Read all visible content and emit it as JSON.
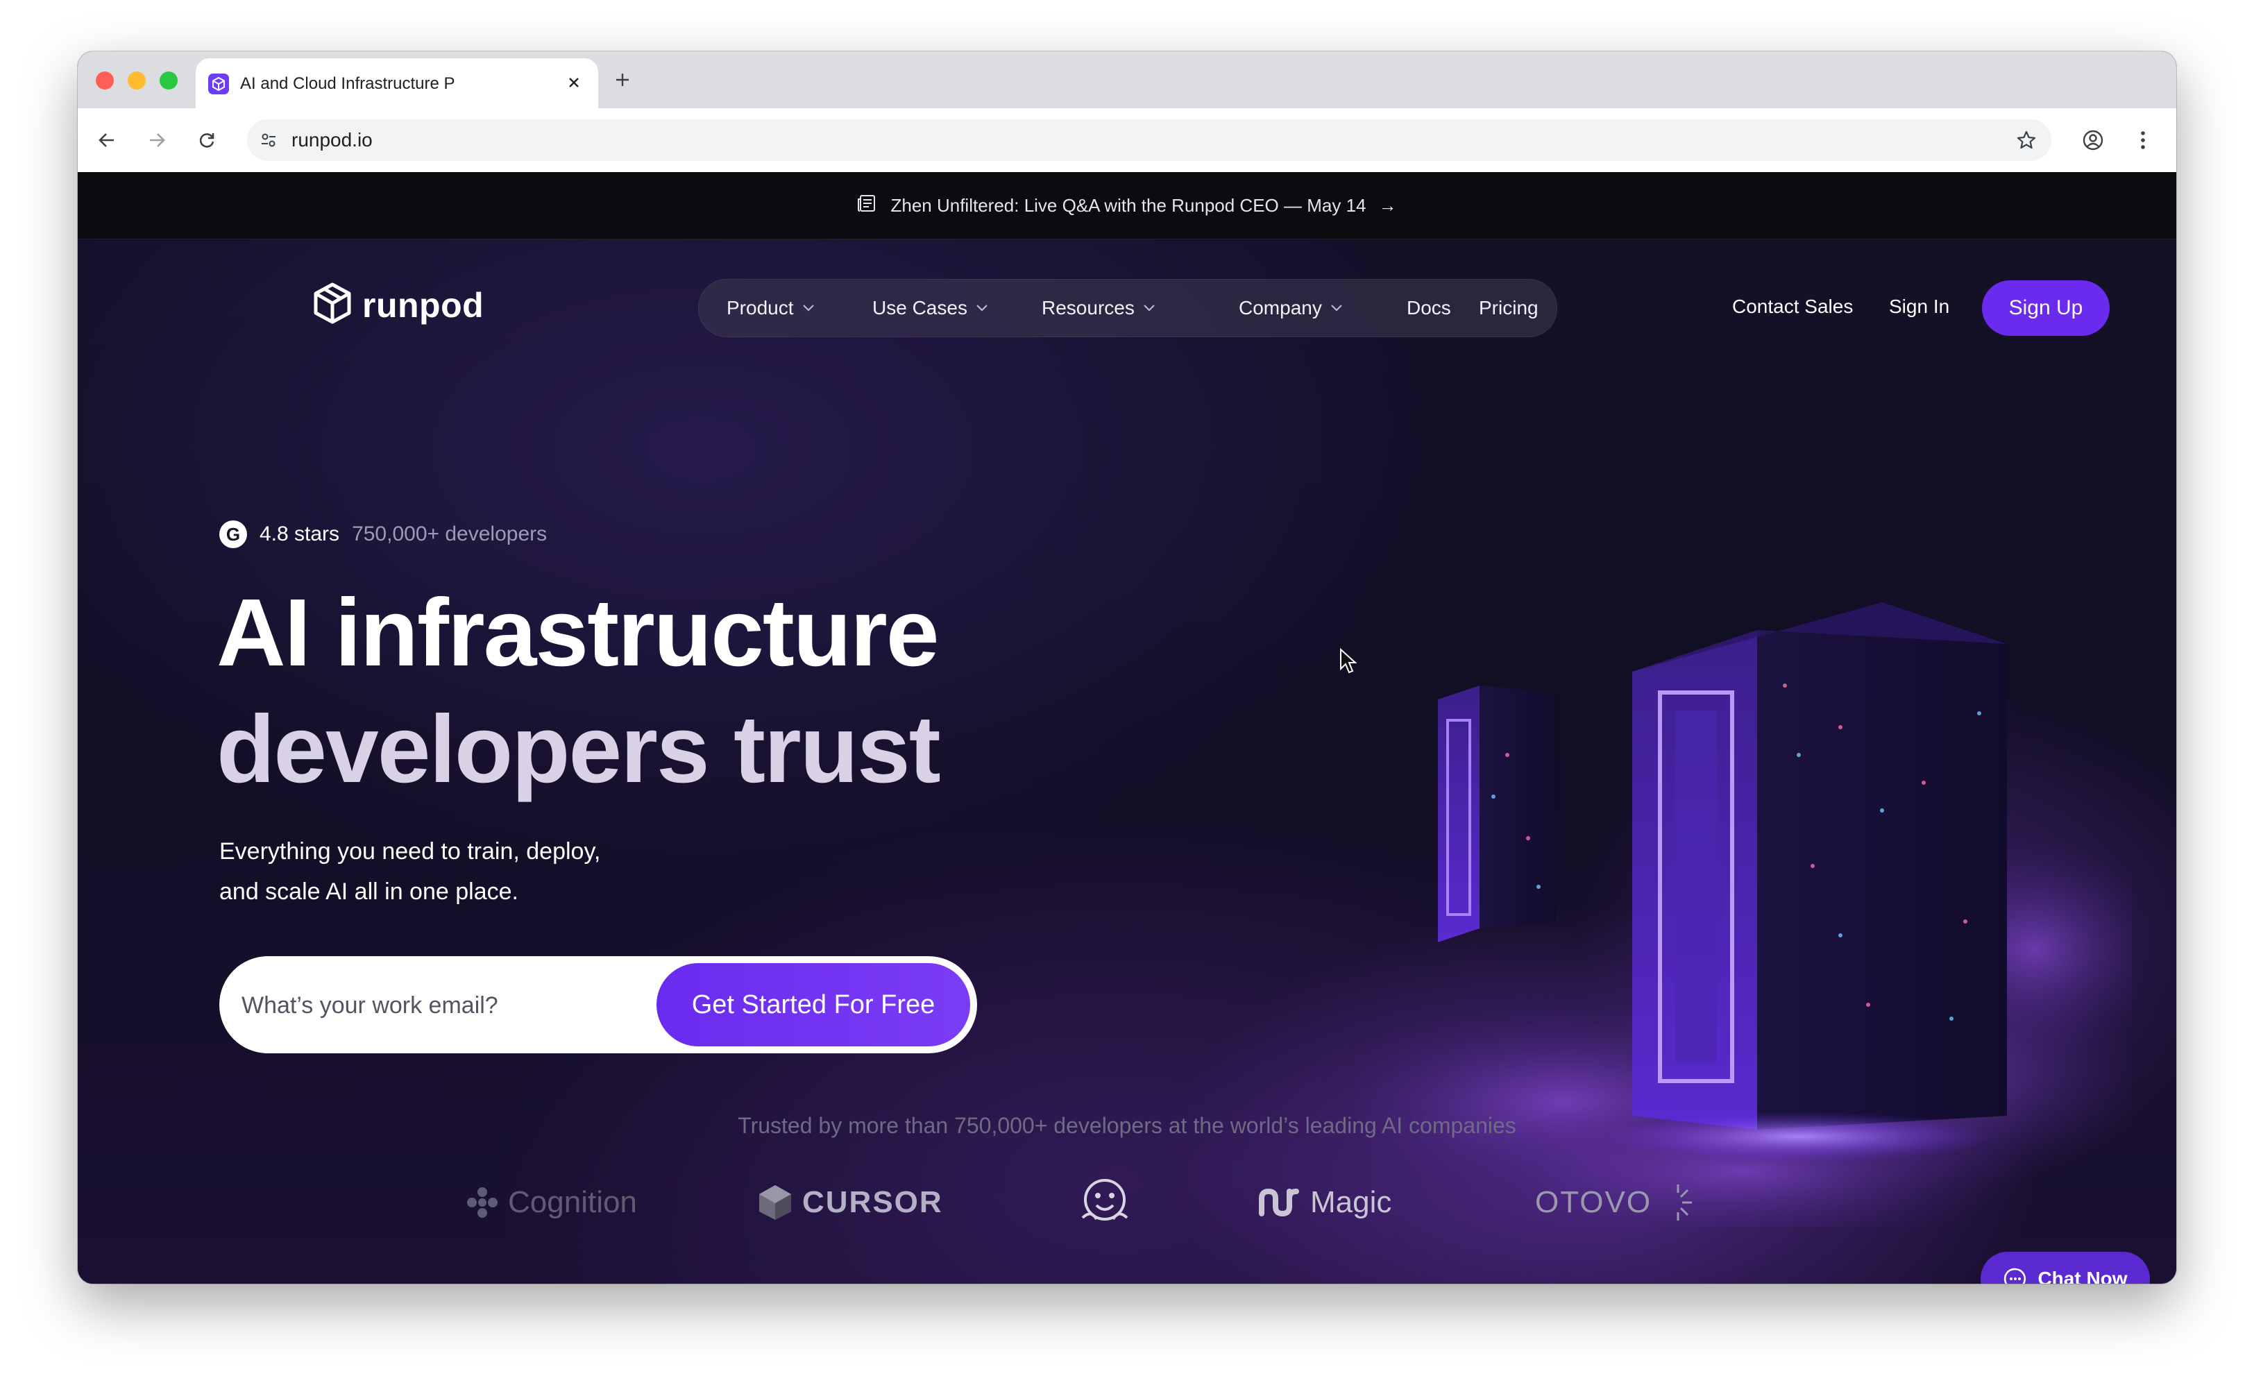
{
  "browser": {
    "tab_title": "AI and Cloud Infrastructure P",
    "url": "runpod.io"
  },
  "banner": {
    "text": "Zhen Unfiltered: Live Q&A with the Runpod CEO — May 14",
    "arrow": "→"
  },
  "header": {
    "logo_text": "runpod",
    "nav": [
      {
        "label": "Product",
        "has_dropdown": true
      },
      {
        "label": "Use Cases",
        "has_dropdown": true
      },
      {
        "label": "Resources",
        "has_dropdown": true
      },
      {
        "label": "Company",
        "has_dropdown": true
      },
      {
        "label": "Docs",
        "has_dropdown": false
      },
      {
        "label": "Pricing",
        "has_dropdown": false
      }
    ],
    "contact_sales": "Contact Sales",
    "sign_in": "Sign In",
    "sign_up": "Sign Up"
  },
  "hero": {
    "rating_badge": "G",
    "rating": "4.8 stars",
    "developers": "750,000+ developers",
    "headline_line1": "AI infrastructure",
    "headline_line2": "developers trust",
    "subtitle_line1": "Everything you need to train, deploy,",
    "subtitle_line2": "and scale AI all in one place.",
    "email_placeholder": "What’s your work email?",
    "cta_label": "Get Started For Free"
  },
  "trusted": {
    "text": "Trusted by more than 750,000+ developers at the world’s leading AI companies",
    "logos": [
      {
        "name": "Cognition",
        "icon": "cognition-logo-icon"
      },
      {
        "name": "CURSOR",
        "icon": "cursor-logo-icon"
      },
      {
        "name": "",
        "icon": "hugging-face-icon"
      },
      {
        "name": "Magic",
        "icon": "magic-logo-icon"
      },
      {
        "name": "OTOVO",
        "icon": "otovo-logo-icon"
      }
    ]
  },
  "chat": {
    "label": "Chat Now"
  },
  "colors": {
    "accent": "#6a2bef",
    "background": "#141027",
    "banner": "#0c0b10"
  }
}
